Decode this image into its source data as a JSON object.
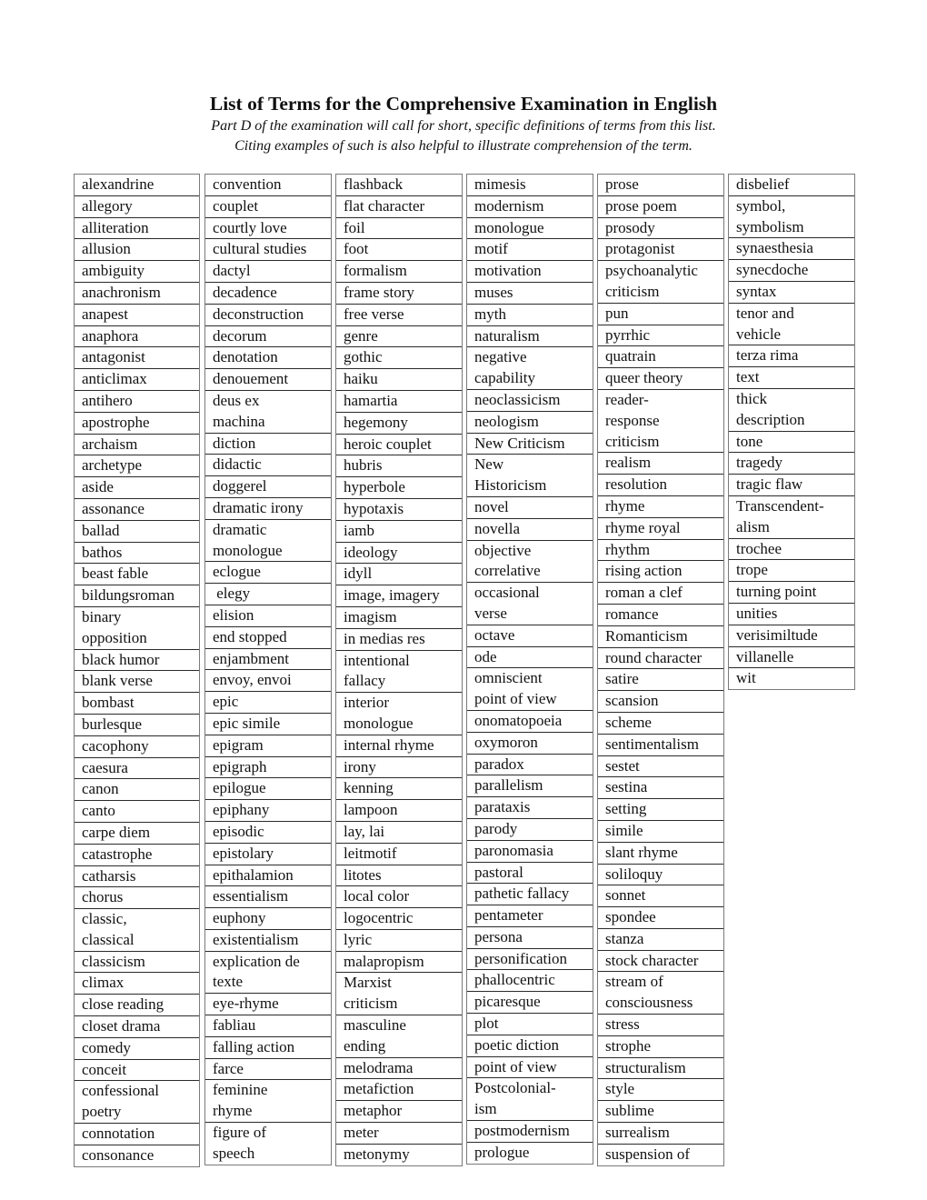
{
  "header": {
    "title": "List of Terms for the Comprehensive Examination in English",
    "subtitle_line1": "Part D of the examination will call for short, specific definitions of terms from this list.",
    "subtitle_line2": "Citing examples of such is also helpful to illustrate comprehension of the term."
  },
  "columns": [
    [
      "alexandrine",
      "allegory",
      "alliteration",
      "allusion",
      "ambiguity",
      "anachronism",
      "anapest",
      "anaphora",
      "antagonist",
      "anticlimax",
      "antihero",
      "apostrophe",
      "archaism",
      "archetype",
      "aside",
      "assonance",
      "ballad",
      "bathos",
      "beast fable",
      "bildungsroman",
      "binary\nopposition",
      "black humor",
      "blank verse",
      "bombast",
      "burlesque",
      "cacophony",
      "caesura",
      "canon",
      "canto",
      "carpe diem",
      "catastrophe",
      "catharsis",
      "chorus",
      "classic,\nclassical",
      "classicism",
      "climax",
      "close reading",
      "closet drama",
      "comedy",
      "conceit",
      "confessional\npoetry",
      "connotation",
      "consonance"
    ],
    [
      "convention",
      "couplet",
      "courtly love",
      "cultural studies",
      "dactyl",
      "decadence",
      "deconstruction",
      "decorum",
      "denotation",
      "denouement",
      "deus ex\nmachina",
      "diction",
      "didactic",
      "doggerel",
      "dramatic irony",
      "dramatic\nmonologue",
      "eclogue",
      " elegy",
      "elision",
      "end stopped",
      "enjambment",
      "envoy, envoi",
      "epic",
      "epic simile",
      "epigram",
      "epigraph",
      "epilogue",
      "epiphany",
      "episodic",
      "epistolary",
      "epithalamion",
      "essentialism",
      "euphony",
      "existentialism",
      "explication de\ntexte",
      "eye-rhyme",
      "fabliau",
      "falling action",
      "farce",
      "feminine\nrhyme",
      "figure of\nspeech"
    ],
    [
      "flashback",
      "flat character",
      "foil",
      "foot",
      "formalism",
      "frame story",
      "free verse",
      "genre",
      "gothic",
      "haiku",
      "hamartia",
      "hegemony",
      "heroic couplet",
      "hubris",
      "hyperbole",
      "hypotaxis",
      "iamb",
      "ideology",
      "idyll",
      "image, imagery",
      "imagism",
      "in medias res",
      "intentional\nfallacy",
      "interior\nmonologue",
      "internal rhyme",
      "irony",
      "kenning",
      "lampoon",
      "lay, lai",
      "leitmotif",
      "litotes",
      "local color",
      "logocentric",
      "lyric",
      "malapropism",
      "Marxist\ncriticism",
      "masculine\nending",
      "melodrama",
      "metafiction",
      "metaphor",
      "meter",
      "metonymy"
    ],
    [
      "mimesis",
      "modernism",
      "monologue",
      "motif",
      "motivation",
      "muses",
      "myth",
      "naturalism",
      "negative\ncapability",
      "neoclassicism",
      "neologism",
      "New Criticism",
      "New\nHistoricism",
      "novel",
      "novella",
      "objective\ncorrelative",
      "occasional\nverse",
      "octave",
      "ode",
      "omniscient\npoint of view",
      "onomatopoeia",
      "oxymoron",
      "paradox",
      "parallelism",
      "parataxis",
      "parody",
      "paronomasia",
      "pastoral",
      "pathetic fallacy",
      "pentameter",
      "persona",
      "personification",
      "phallocentric",
      "picaresque",
      "plot",
      "poetic diction",
      "point of view",
      "Postcolonial-\nism",
      "postmodernism",
      "prologue"
    ],
    [
      "prose",
      "prose poem",
      "prosody",
      "protagonist",
      "psychoanalytic\ncriticism",
      "pun",
      "pyrrhic",
      "quatrain",
      "queer theory",
      "reader-\nresponse\ncriticism",
      "realism",
      "resolution",
      "rhyme",
      "rhyme royal",
      "rhythm",
      "rising action",
      "roman a clef",
      "romance",
      "Romanticism",
      "round character",
      "satire",
      "scansion",
      "scheme",
      "sentimentalism",
      "sestet",
      "sestina",
      "setting",
      "simile",
      "slant rhyme",
      "soliloquy",
      "sonnet",
      "spondee",
      "stanza",
      "stock character",
      "stream of\nconsciousness",
      "stress",
      "strophe",
      "structuralism",
      "style",
      "sublime",
      "surrealism",
      "suspension of"
    ],
    [
      "disbelief",
      "symbol,\nsymbolism",
      "synaesthesia",
      "synecdoche",
      "syntax",
      "tenor and\nvehicle",
      "terza rima",
      "text",
      "thick\ndescription",
      "tone",
      "tragedy",
      "tragic flaw",
      "Transcendent-\nalism",
      "trochee",
      "trope",
      "turning point",
      "unities",
      "verisimiltude",
      "villanelle",
      "wit"
    ]
  ]
}
